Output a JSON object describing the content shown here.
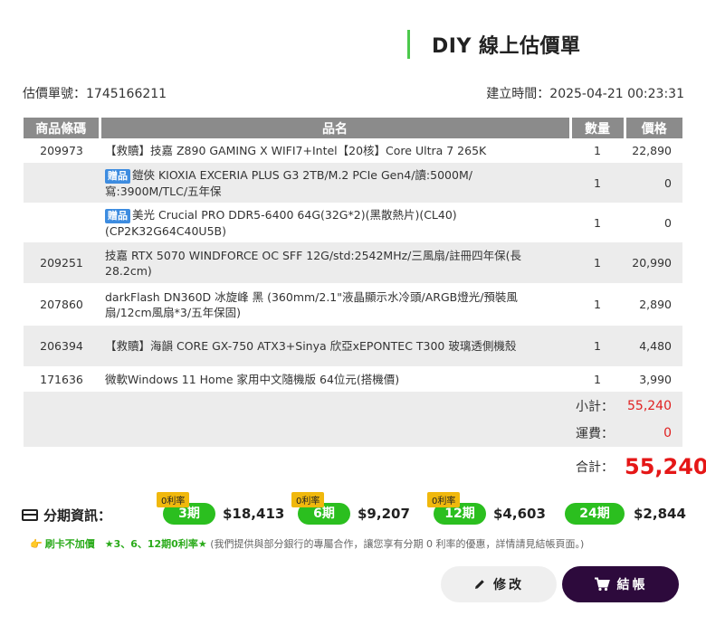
{
  "header": {
    "title": "DIY 線上估價單"
  },
  "meta": {
    "quote_no": "估價單號：1745166211",
    "created": "建立時間：2025-04-21 00:23:31"
  },
  "table": {
    "headers": [
      "商品條碼",
      "品名",
      "數量",
      "價格"
    ],
    "rows": [
      {
        "code": "209973",
        "gift": "",
        "name": "【救贖】技嘉 Z890 GAMING X WIFI7+Intel【20核】Core Ultra 7 265K",
        "qty": "1",
        "price": "22,890"
      },
      {
        "code": "",
        "gift": "贈品",
        "name": "鎧俠 KIOXIA EXCERIA PLUS G3 2TB/M.2 PCIe Gen4/讀:5000M/寫:3900M/TLC/五年保",
        "qty": "1",
        "price": "0"
      },
      {
        "code": "",
        "gift": "贈品",
        "name": "美光 Crucial PRO DDR5-6400 64G(32G*2)(黑散熱片)(CL40)(CP2K32G64C40U5B)",
        "qty": "1",
        "price": "0"
      },
      {
        "code": "209251",
        "gift": "",
        "name": "技嘉 RTX 5070 WINDFORCE OC SFF 12G/std:2542MHz/三風扇/註冊四年保(長28.2cm)",
        "qty": "1",
        "price": "20,990"
      },
      {
        "code": "207860",
        "gift": "",
        "name": "darkFlash DN360D 冰旋峰 黑 (360mm/2.1\"液晶顯示水冷頭/ARGB燈光/預裝風扇/12cm風扇*3/五年保固)",
        "qty": "1",
        "price": "2,890"
      },
      {
        "code": "206394",
        "gift": "",
        "name": "【救贖】海韻 CORE GX-750 ATX3+Sinya 欣亞xEPONTEC T300 玻璃透側機殼",
        "qty": "1",
        "price": "4,480"
      },
      {
        "code": "171636",
        "gift": "",
        "name": "微軟Windows 11 Home 家用中文隨機版 64位元(搭機價)",
        "qty": "1",
        "price": "3,990"
      }
    ],
    "subtotal_label": "小計：",
    "subtotal": "55,240",
    "shipping_label": "運費：",
    "shipping": "0",
    "total_label": "合計：",
    "total": "55,240"
  },
  "installments": {
    "label": "分期資訊：",
    "plans": [
      {
        "badge": "0利率",
        "term": "3期",
        "amount": "$18,413"
      },
      {
        "badge": "0利率",
        "term": "6期",
        "amount": "$9,207"
      },
      {
        "badge": "0利率",
        "term": "12期",
        "amount": "$4,603"
      },
      {
        "badge": "",
        "term": "24期",
        "amount": "$2,844"
      }
    ]
  },
  "note": {
    "icon": "👉",
    "highlight": "刷卡不加價　★3、6、12期0利率★",
    "text": "(我們提供與部分銀行的專屬合作，讓您享有分期 0 利率的優惠，詳情請見結帳頁面。)"
  },
  "buttons": {
    "edit": "修改",
    "checkout": "結帳"
  },
  "colors": {
    "accent_green": "#2bbf1f",
    "badge_yellow": "#f0b80d",
    "total_red": "#e51717",
    "checkout_bg": "#2d0a3c"
  }
}
